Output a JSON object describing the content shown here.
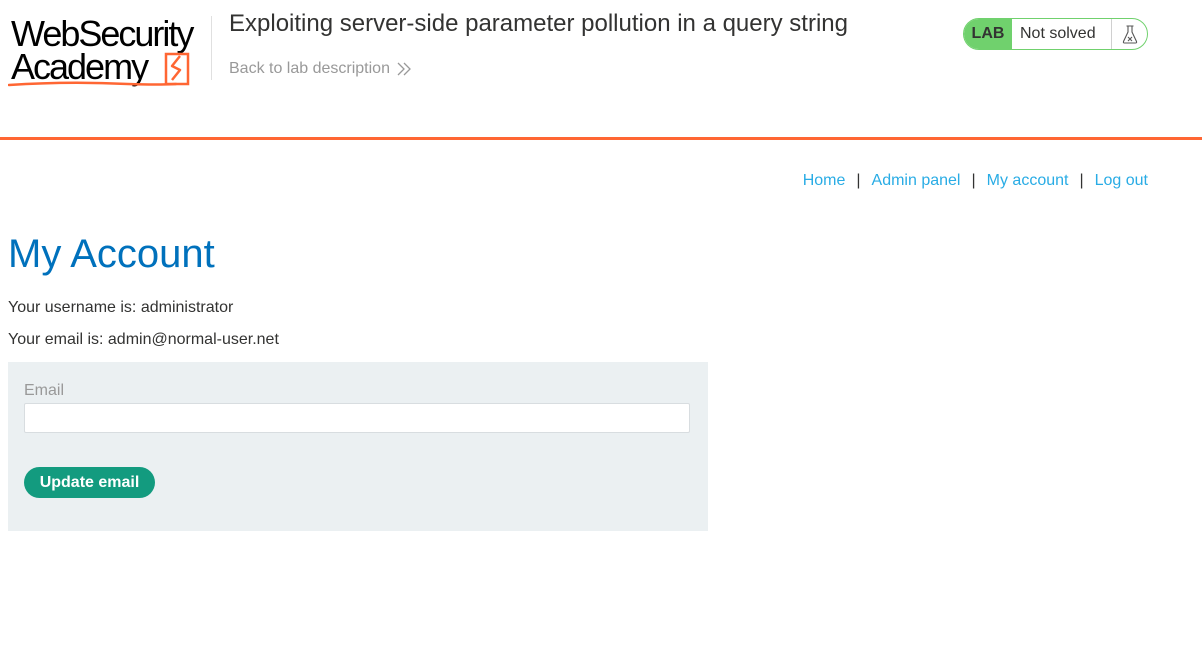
{
  "header": {
    "logo": {
      "line1": "WebSecurity",
      "line2": "Academy",
      "icon": "lightning-bolt-icon"
    },
    "lab_title": "Exploiting server-side parameter pollution in a query string",
    "back_link": "Back to lab description",
    "back_icon": "double-chevron-right-icon",
    "status": {
      "badge": "LAB",
      "text": "Not solved",
      "icon": "flask-icon"
    }
  },
  "nav": {
    "items": [
      "Home",
      "Admin panel",
      "My account",
      "Log out"
    ],
    "separator": "|"
  },
  "main": {
    "title": "My Account",
    "username_line": "Your username is: administrator",
    "email_line": "Your email is: admin@normal-user.net",
    "form": {
      "email_label": "Email",
      "email_value": "",
      "submit_label": "Update email"
    }
  },
  "colors": {
    "accent_orange": "#ff6633",
    "title_blue": "#0071bc",
    "link_blue": "#29ace5",
    "lab_green": "#70d16d",
    "button_green": "#139b7f",
    "panel_bg": "#ebf0f2"
  }
}
